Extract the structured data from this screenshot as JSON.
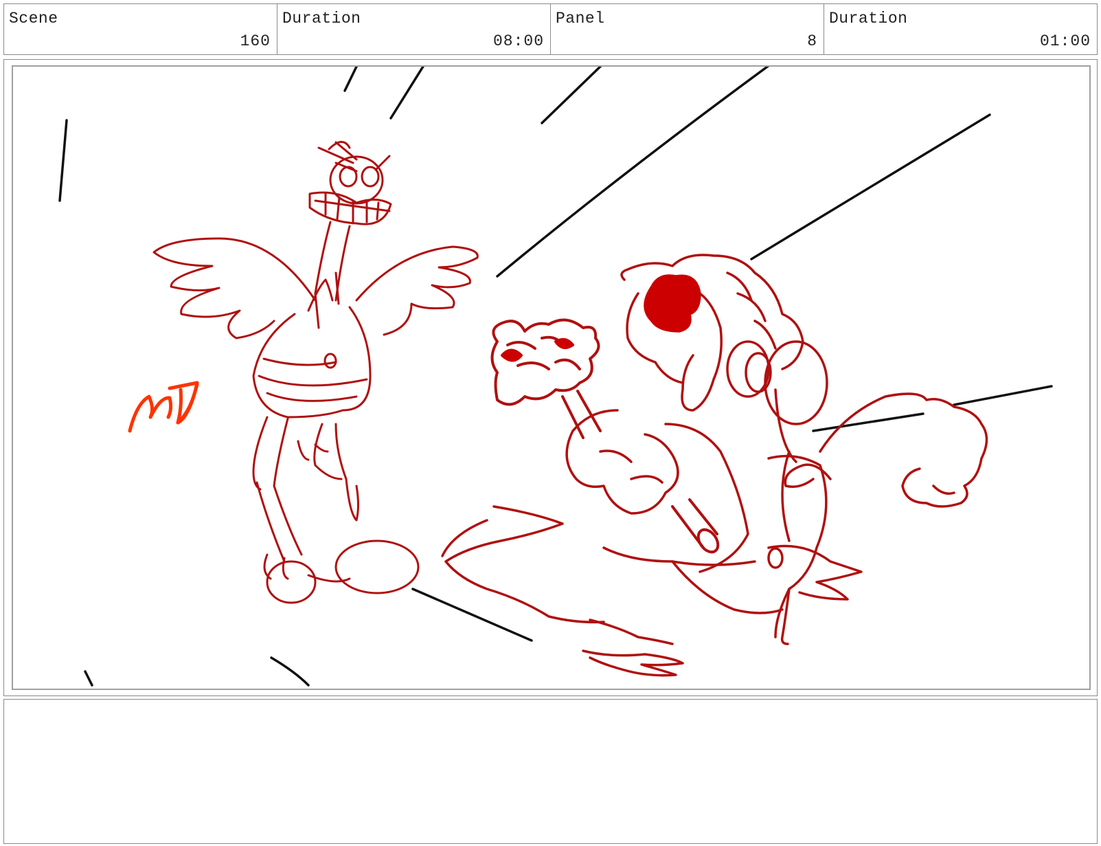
{
  "header": {
    "scene_label": "Scene",
    "scene_value": "160",
    "scene_duration_label": "Duration",
    "scene_duration_value": "08:00",
    "panel_label": "Panel",
    "panel_value": "8",
    "panel_duration_label": "Duration",
    "panel_duration_value": "01:00"
  },
  "drawing": {
    "line_color": "#b01010",
    "fill_color": "#cc0000",
    "signature_color": "#ff3300",
    "speed_line_color": "#111111",
    "subjects": [
      "angry ostrich with spread wings",
      "round figure holding a scepter"
    ],
    "signature": "MD"
  },
  "notes": {
    "text": ""
  }
}
